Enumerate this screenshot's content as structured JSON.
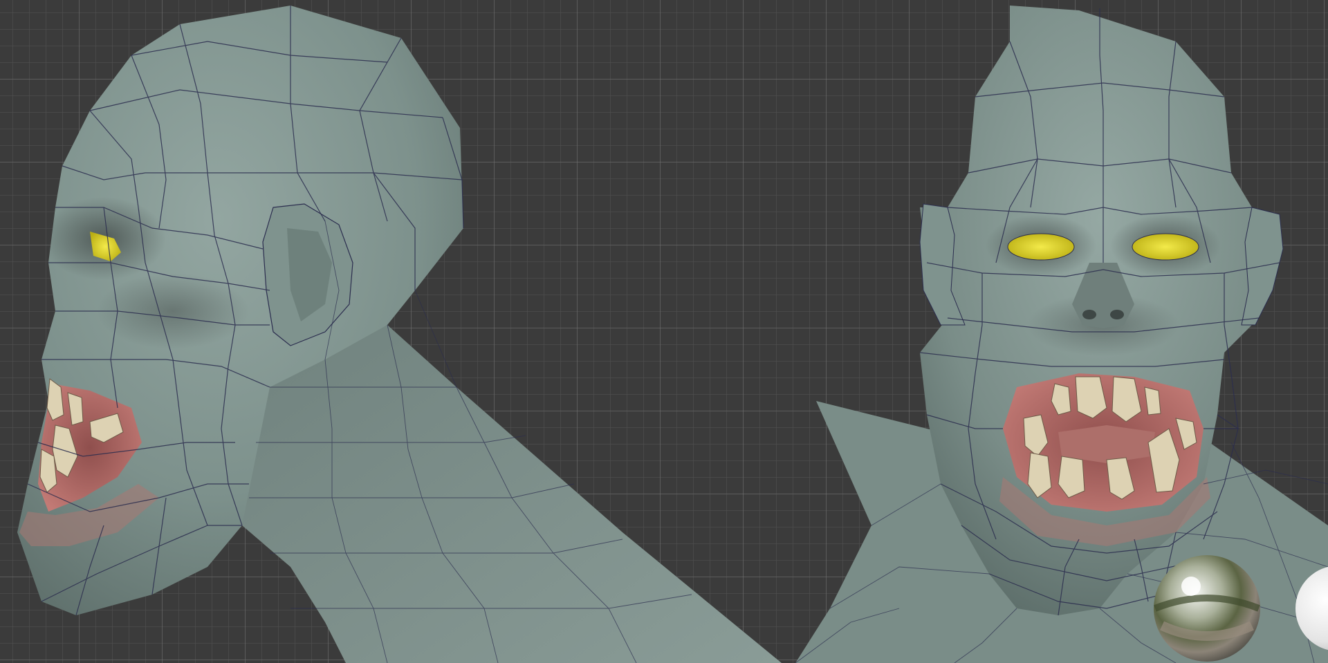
{
  "viewport": {
    "background_color": "#3b3b3b",
    "grid_color": "#6e6e6e"
  },
  "model": {
    "skin_color": "#7c8f8a",
    "eye_color": "#e0d52a",
    "gum_color": "#b9716d",
    "tooth_color": "#ddd2b3",
    "wire_color": "#2b2d4e"
  },
  "views": [
    {
      "name": "side-view"
    },
    {
      "name": "front-view"
    }
  ],
  "widgets": {
    "hdri_preview_icon": "hdri-sphere-icon",
    "matcap_preview_icon": "white-sphere-icon"
  }
}
